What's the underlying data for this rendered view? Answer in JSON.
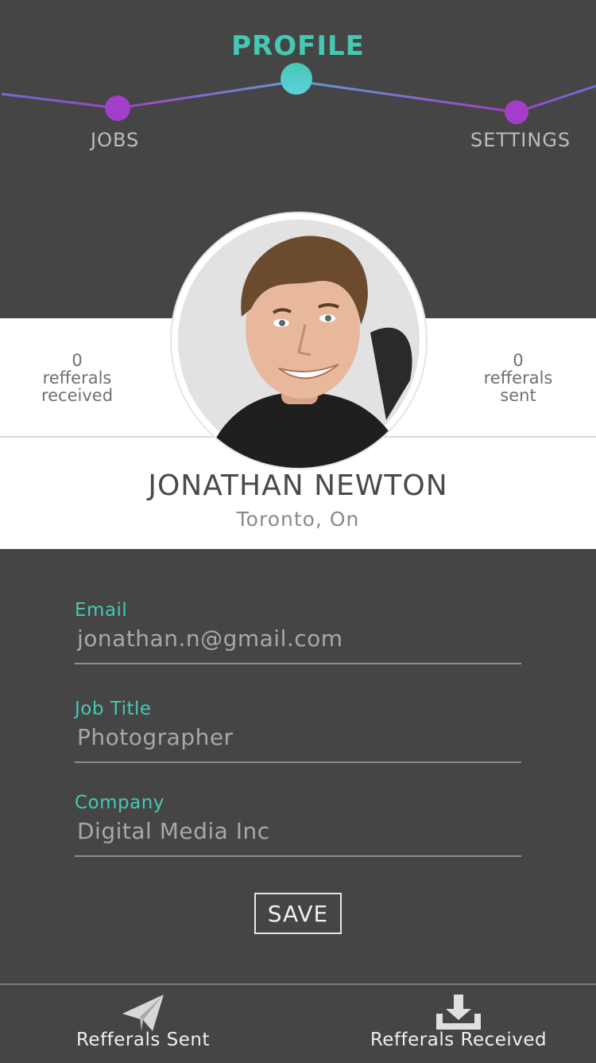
{
  "nav": {
    "jobs_label": "JOBS",
    "profile_label": "PROFILE",
    "settings_label": "SETTINGS",
    "active": "PROFILE",
    "accent_color": "#45c9b4",
    "dot_color": "#a23ec8"
  },
  "profile": {
    "name": "JONATHAN NEWTON",
    "location": "Toronto, On",
    "avatar": "profile-photo",
    "stats": {
      "received": {
        "count": "0",
        "line1": "refferals",
        "line2": "received"
      },
      "sent": {
        "count": "0",
        "line1": "refferals",
        "line2": "sent"
      }
    }
  },
  "form": {
    "email": {
      "label": "Email",
      "value": "jonathan.n@gmail.com"
    },
    "job_title": {
      "label": "Job Title",
      "value": "Photographer"
    },
    "company": {
      "label": "Company",
      "value": "Digital Media Inc"
    },
    "save_label": "SAVE"
  },
  "bottom_tabs": {
    "sent": {
      "label": "Refferals Sent",
      "icon": "paper-plane-icon"
    },
    "received": {
      "label": "Refferals Received",
      "icon": "download-tray-icon"
    }
  },
  "colors": {
    "background": "#454545",
    "card": "#ffffff",
    "accent": "#45c9b4"
  }
}
